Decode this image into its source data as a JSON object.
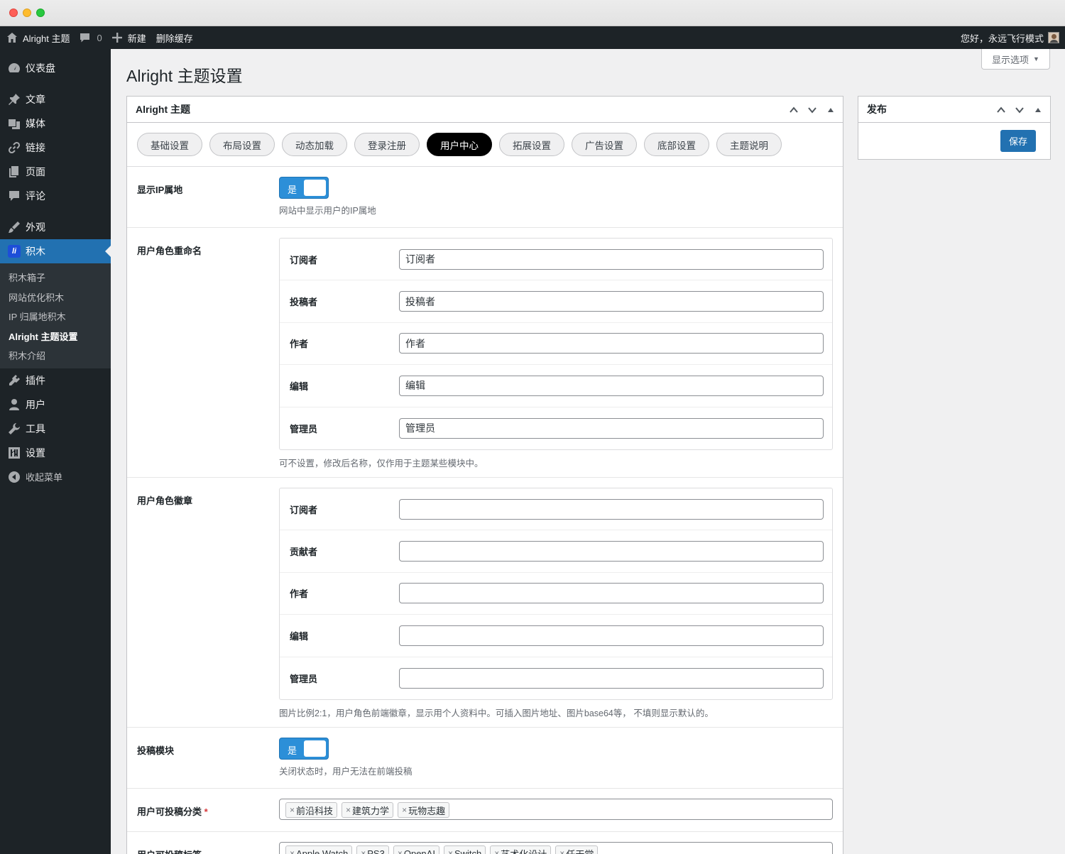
{
  "adminbar": {
    "site_name": "Alright 主题",
    "comments_count": "0",
    "new_label": "新建",
    "clear_cache_label": "删除缓存",
    "greeting": "您好，永远飞行模式"
  },
  "sidebar": {
    "dashboard": "仪表盘",
    "posts": "文章",
    "media": "媒体",
    "links": "链接",
    "pages": "页面",
    "comments": "评论",
    "appearance": "外观",
    "jimu": "积木",
    "jimu_sub": [
      "积木箱子",
      "网站优化积木",
      "IP 归属地积木",
      "Alright 主题设置",
      "积木介绍"
    ],
    "plugins": "插件",
    "users": "用户",
    "tools": "工具",
    "settings": "设置",
    "collapse": "收起菜单"
  },
  "screen_options": "显示选项",
  "page_title": "Alright 主题设置",
  "main_box": {
    "title": "Alright 主题",
    "tabs": [
      "基础设置",
      "布局设置",
      "动态加载",
      "登录注册",
      "用户中心",
      "拓展设置",
      "广告设置",
      "底部设置",
      "主题说明"
    ],
    "active_tab": "用户中心"
  },
  "fields": {
    "show_ip": {
      "label": "显示IP属地",
      "toggle_text": "是",
      "desc": "网站中显示用户的IP属地"
    },
    "role_rename": {
      "label": "用户角色重命名",
      "rows": [
        {
          "label": "订阅者",
          "value": "订阅者"
        },
        {
          "label": "投稿者",
          "value": "投稿者"
        },
        {
          "label": "作者",
          "value": "作者"
        },
        {
          "label": "编辑",
          "value": "编辑"
        },
        {
          "label": "管理员",
          "value": "管理员"
        }
      ],
      "desc": "可不设置，修改后名称，仅作用于主题某些模块中。"
    },
    "role_badge": {
      "label": "用户角色徽章",
      "rows": [
        {
          "label": "订阅者",
          "value": ""
        },
        {
          "label": "贡献者",
          "value": ""
        },
        {
          "label": "作者",
          "value": ""
        },
        {
          "label": "编辑",
          "value": ""
        },
        {
          "label": "管理员",
          "value": ""
        }
      ],
      "desc": "图片比例2:1，用户角色前端徽章，显示用个人资料中。可插入图片地址、图片base64等， 不填则显示默认的。"
    },
    "submit_module": {
      "label": "投稿模块",
      "toggle_text": "是",
      "desc": "关闭状态时，用户无法在前端投稿"
    },
    "submit_categories": {
      "label": "用户可投稿分类",
      "required_mark": "*",
      "tags": [
        "前沿科技",
        "建筑力学",
        "玩物志趣"
      ]
    },
    "submit_tags": {
      "label": "用户可投稿标签",
      "tags": [
        "Apple Watch",
        "PS3",
        "OpenAI",
        "Switch",
        "艺术化设计",
        "任天堂"
      ]
    }
  },
  "publish_box": {
    "title": "发布",
    "save_label": "保存"
  },
  "colors": {
    "admin_dark": "#1d2327",
    "accent": "#2271b1",
    "toggle_on": "#2c8fd8"
  }
}
